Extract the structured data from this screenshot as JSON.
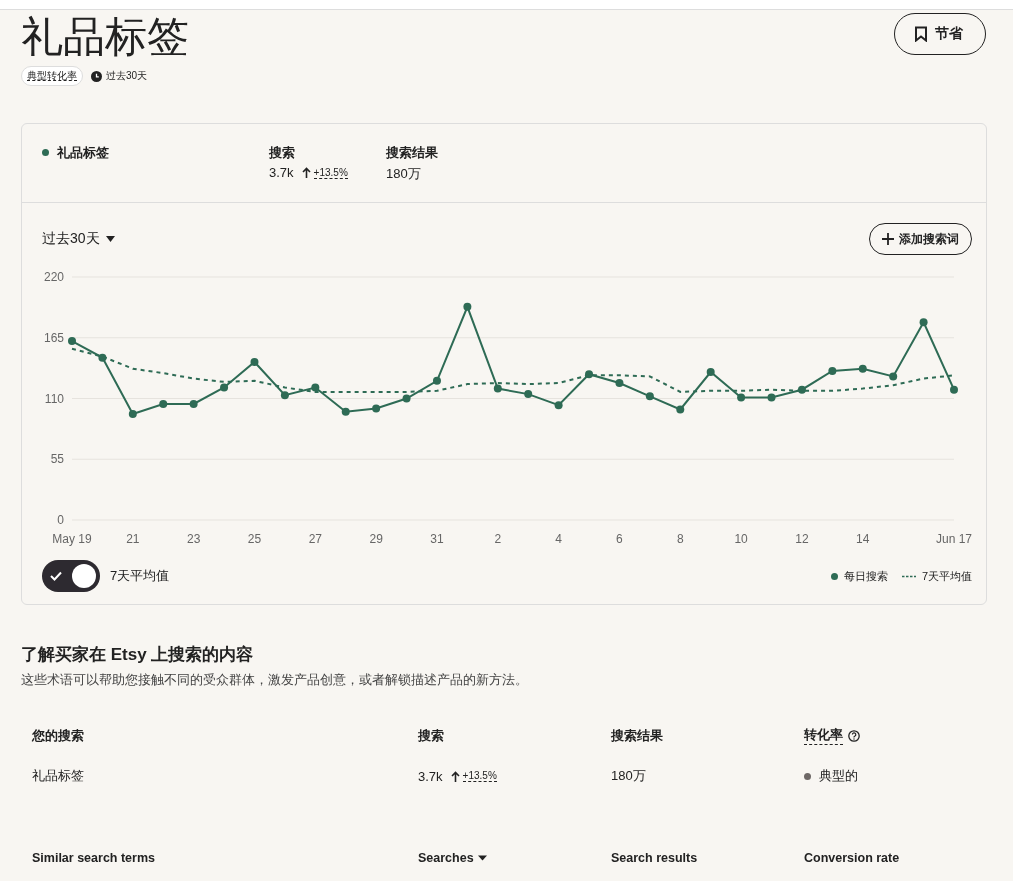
{
  "header": {
    "title": "礼品标签",
    "badge": "典型转化率",
    "period": "过去30天",
    "save_button": "节省"
  },
  "summary_card": {
    "keyword": {
      "label": "礼品标签",
      "color": "#2e6b55"
    },
    "stats": [
      {
        "label": "搜索",
        "value": "3.7k",
        "change": "+13.5%"
      },
      {
        "label": "搜索结果",
        "value": "180万"
      }
    ]
  },
  "chart_panel": {
    "range_dropdown": "过去30天",
    "add_button": "添加搜索词",
    "chart_data": {
      "type": "line",
      "categories": [
        "May 19",
        null,
        "21",
        null,
        "23",
        null,
        "25",
        null,
        "27",
        null,
        "29",
        null,
        "31",
        null,
        "2",
        null,
        "4",
        null,
        "6",
        null,
        "8",
        null,
        "10",
        null,
        "12",
        null,
        "14",
        null,
        null,
        "Jun 17"
      ],
      "series": [
        {
          "name": "每日搜索",
          "color": "#2e6b55",
          "line_style": "solid",
          "marker": "circle",
          "values": [
            162,
            147,
            96,
            105,
            105,
            120,
            143,
            113,
            120,
            98,
            101,
            110,
            126,
            193,
            119,
            114,
            104,
            132,
            124,
            112,
            100,
            134,
            111,
            111,
            118,
            135,
            137,
            130,
            179,
            118
          ]
        },
        {
          "name": "7天平均值",
          "color": "#2e6b55",
          "line_style": "dashed",
          "values": [
            155,
            148,
            137,
            133,
            128,
            125,
            126,
            120,
            116,
            116,
            116,
            116,
            117,
            123,
            124,
            123,
            124,
            131,
            131,
            130,
            116,
            117,
            117,
            118,
            117,
            117,
            119,
            122,
            128,
            131
          ]
        }
      ],
      "ylim": [
        0,
        220
      ],
      "yticks": [
        0,
        55,
        110,
        165,
        220
      ],
      "grid": true
    },
    "average_toggle": {
      "label": "7天平均值",
      "on": true
    }
  },
  "insights": {
    "heading": "了解买家在 Etsy 上搜索的内容",
    "description": "这些术语可以帮助您接触不同的受众群体，激发产品创意，或者解锁描述产品的新方法。",
    "your_search": {
      "columns": [
        {
          "label": "您的搜索"
        },
        {
          "label": "搜索"
        },
        {
          "label": "搜索结果"
        },
        {
          "label": "转化率",
          "help": true
        }
      ],
      "rows": [
        {
          "keyword": "礼品标签",
          "searches": "3.7k",
          "change": "+13.5%",
          "results": "180万",
          "conversion": "典型的",
          "color": "#6e6866"
        }
      ]
    },
    "similar": {
      "columns": [
        {
          "label": "Similar search terms"
        },
        {
          "label": "Searches",
          "sortable": true
        },
        {
          "label": "Search results"
        },
        {
          "label": "Conversion rate"
        }
      ]
    }
  }
}
